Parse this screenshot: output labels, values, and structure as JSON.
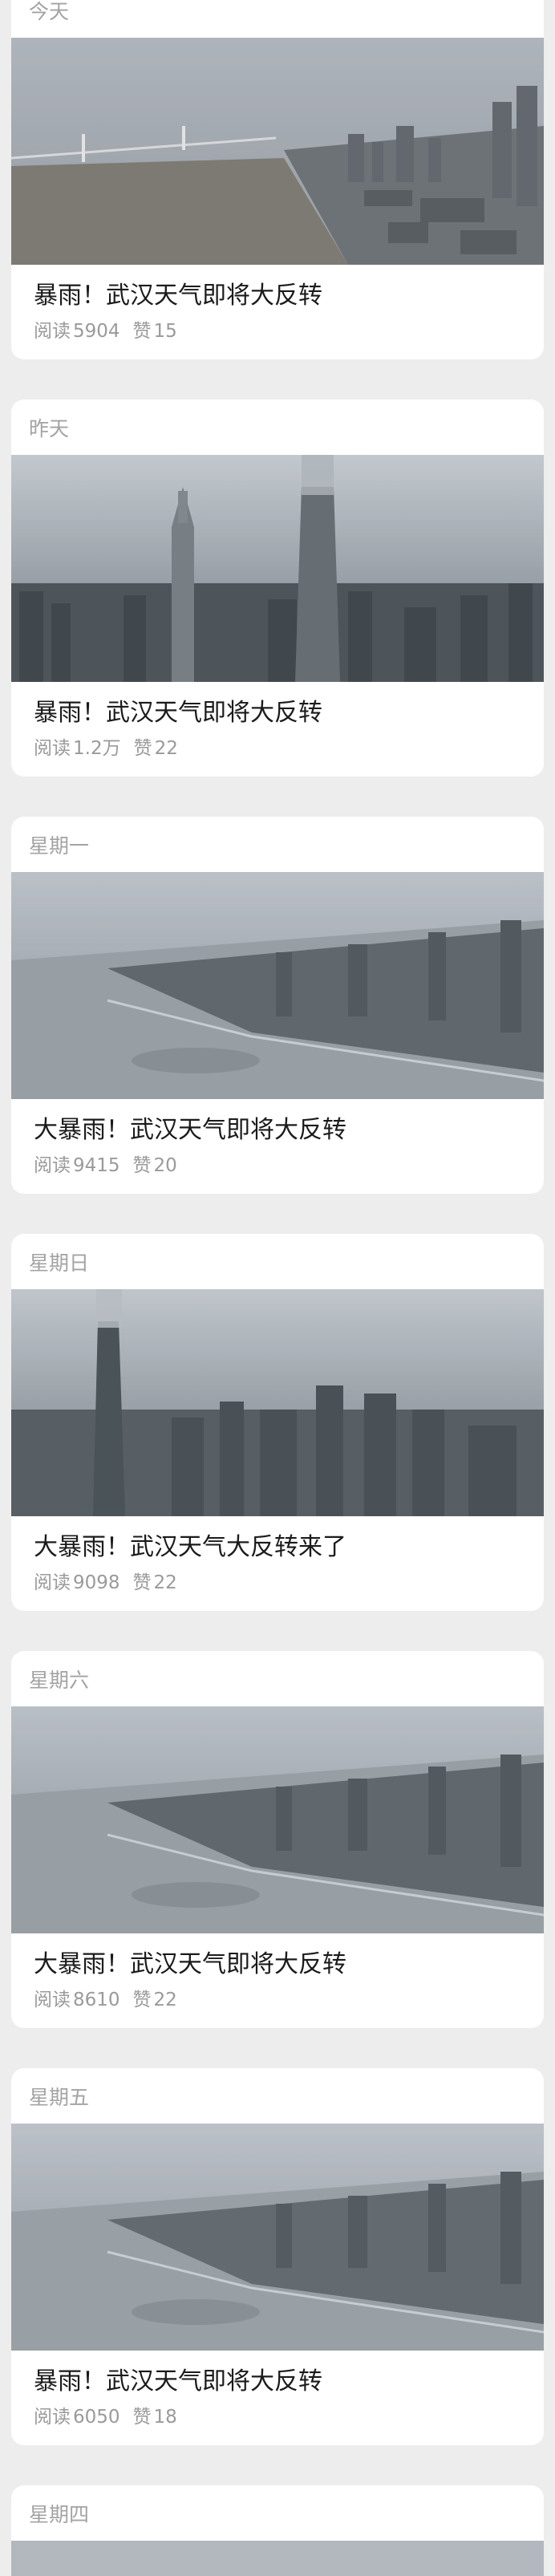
{
  "labels": {
    "reads": "阅读",
    "likes": "赞"
  },
  "posts": [
    {
      "day": "今天",
      "title": "暴雨！武汉天气即将大反转",
      "reads": "5904",
      "likes": "15",
      "image": "bridge-river-city-fog"
    },
    {
      "day": "昨天",
      "title": "暴雨！武汉天气即将大反转",
      "reads": "1.2万",
      "likes": "22",
      "image": "skyscrapers-fog"
    },
    {
      "day": "星期一",
      "title": "大暴雨！武汉天气即将大反转",
      "reads": "9415",
      "likes": "20",
      "image": "riverbank-fog"
    },
    {
      "day": "星期日",
      "title": "大暴雨！武汉天气大反转来了",
      "reads": "9098",
      "likes": "22",
      "image": "tower-clouds-city"
    },
    {
      "day": "星期六",
      "title": "大暴雨！武汉天气即将大反转",
      "reads": "8610",
      "likes": "22",
      "image": "riverbank-fog"
    },
    {
      "day": "星期五",
      "title": "暴雨！武汉天气即将大反转",
      "reads": "6050",
      "likes": "18",
      "image": "riverbank-fog"
    },
    {
      "day": "星期四",
      "image": "riverbank-fog"
    }
  ]
}
